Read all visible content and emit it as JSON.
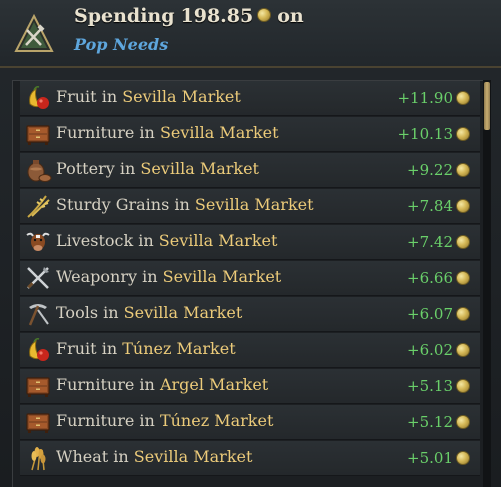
{
  "header": {
    "title_prefix": "Spending",
    "amount": "198.85",
    "title_suffix": "on",
    "subtitle": "Pop Needs",
    "emblem_icon": "triangle-tools-emblem-icon"
  },
  "colors": {
    "positive": "#6ad06a",
    "market": "#eccb7a",
    "link": "#5ea6dd",
    "coin": "#d4b756"
  },
  "rows": [
    {
      "good": "Fruit",
      "connector": "in",
      "market": "Sevilla Market",
      "value": "+11.90",
      "icon": "fruit-icon"
    },
    {
      "good": "Furniture",
      "connector": "in",
      "market": "Sevilla Market",
      "value": "+10.13",
      "icon": "furniture-icon"
    },
    {
      "good": "Pottery",
      "connector": "in",
      "market": "Sevilla Market",
      "value": "+9.22",
      "icon": "pottery-icon"
    },
    {
      "good": "Sturdy Grains",
      "connector": "in",
      "market": "Sevilla Market",
      "value": "+7.84",
      "icon": "sturdy-grains-icon"
    },
    {
      "good": "Livestock",
      "connector": "in",
      "market": "Sevilla Market",
      "value": "+7.42",
      "icon": "livestock-icon"
    },
    {
      "good": "Weaponry",
      "connector": "in",
      "market": "Sevilla Market",
      "value": "+6.66",
      "icon": "weaponry-icon"
    },
    {
      "good": "Tools",
      "connector": "in",
      "market": "Sevilla Market",
      "value": "+6.07",
      "icon": "tools-icon"
    },
    {
      "good": "Fruit",
      "connector": "in",
      "market": "Túnez Market",
      "value": "+6.02",
      "icon": "fruit-icon"
    },
    {
      "good": "Furniture",
      "connector": "in",
      "market": "Argel Market",
      "value": "+5.13",
      "icon": "furniture-icon"
    },
    {
      "good": "Furniture",
      "connector": "in",
      "market": "Túnez Market",
      "value": "+5.12",
      "icon": "furniture-icon"
    },
    {
      "good": "Wheat",
      "connector": "in",
      "market": "Sevilla Market",
      "value": "+5.01",
      "icon": "wheat-icon"
    }
  ]
}
